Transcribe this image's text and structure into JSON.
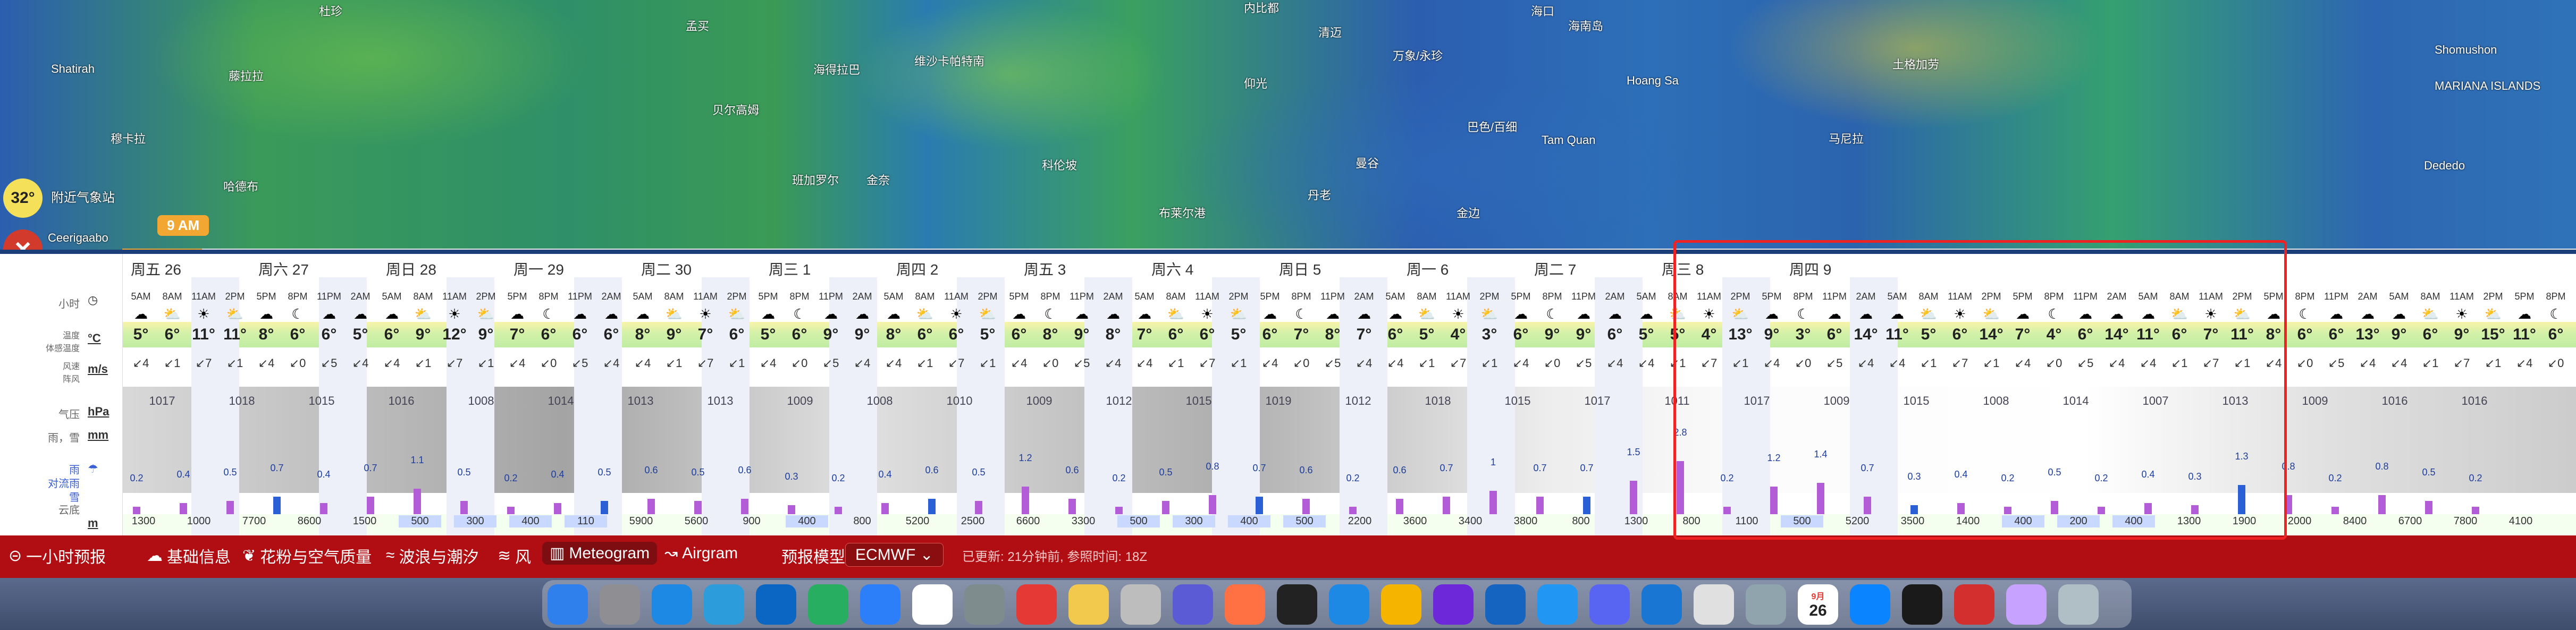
{
  "map": {
    "temp_badge": "32°",
    "nearby_station": "附近气象站",
    "time_tag": "9 AM",
    "cities": [
      {
        "name": "Shatirah"
      },
      {
        "name": "杜珍"
      },
      {
        "name": "藤拉拉"
      },
      {
        "name": "穆卡拉"
      },
      {
        "name": "哈德布"
      },
      {
        "name": "Ceerigaabo"
      },
      {
        "name": "孟买"
      },
      {
        "name": "海得拉巴"
      },
      {
        "name": "维沙卡帕特南"
      },
      {
        "name": "贝尔高姆"
      },
      {
        "name": "班加罗尔"
      },
      {
        "name": "金奈"
      },
      {
        "name": "科伦坡"
      },
      {
        "name": "内比都"
      },
      {
        "name": "清迈"
      },
      {
        "name": "曼谷"
      },
      {
        "name": "万象/永珍"
      },
      {
        "name": "仰光"
      },
      {
        "name": "巴色/百细"
      },
      {
        "name": "丹老"
      },
      {
        "name": "布莱尔港"
      },
      {
        "name": "海口"
      },
      {
        "name": "海南岛"
      },
      {
        "name": "Hoang Sa"
      },
      {
        "name": "Tam Quan"
      },
      {
        "name": "金边"
      },
      {
        "name": "马尼拉"
      },
      {
        "name": "土格加劳"
      },
      {
        "name": "Shomushon"
      },
      {
        "name": "MARIANA ISLANDS"
      },
      {
        "name": "Dededo"
      },
      {
        "name": "马尼拉"
      }
    ]
  },
  "meteogram": {
    "labels": {
      "hour": "小时",
      "temp": "温度\n体感温度",
      "temp_unit": "°C",
      "wind": "风速\n阵风",
      "wind_unit": "m/s",
      "pressure": "气压",
      "pressure_unit": "hPa",
      "rain_snow": "雨，雪",
      "rain_unit": "mm",
      "rain": "雨",
      "rain_hourly": "对流雨",
      "snow": "雪",
      "cloud_base": "云底",
      "cloud_unit": "m"
    },
    "days": [
      "周五 26",
      "周六 27",
      "周日 28",
      "周一 29",
      "周二 30",
      "周三 1",
      "周四 2",
      "周五 3",
      "周六 4",
      "周日 5",
      "周一 6",
      "周二 7",
      "周三 8",
      "周四 9"
    ],
    "hours": [
      "5AM",
      "8AM",
      "11AM",
      "2PM",
      "5PM",
      "8PM",
      "11PM",
      "2AM"
    ],
    "temps": [
      "5°",
      "6°",
      "11°",
      "11°",
      "8°",
      "6°",
      "6°",
      "5°",
      "6°",
      "9°",
      "12°",
      "9°",
      "7°",
      "6°",
      "6°",
      "6°",
      "8°",
      "9°",
      "7°",
      "6°",
      "5°",
      "6°",
      "9°",
      "9°",
      "8°",
      "6°",
      "6°",
      "5°",
      "6°",
      "8°",
      "9°",
      "8°",
      "7°",
      "6°",
      "6°",
      "5°",
      "6°",
      "7°",
      "8°",
      "7°",
      "6°",
      "5°",
      "4°",
      "3°",
      "6°",
      "9°",
      "9°",
      "6°",
      "5°",
      "5°",
      "4°",
      "13°",
      "9°",
      "3°",
      "6°",
      "14°",
      "11°",
      "5°",
      "6°",
      "14°",
      "7°",
      "4°",
      "6°",
      "14°",
      "11°",
      "6°",
      "7°",
      "11°",
      "8°",
      "6°",
      "6°",
      "13°",
      "9°",
      "6°",
      "9°",
      "15°",
      "11°",
      "6°"
    ],
    "pressures": [
      "1017",
      "1018",
      "1015",
      "1016",
      "1008",
      "1014",
      "1013",
      "1013",
      "1009",
      "1008",
      "1010",
      "1009",
      "1012",
      "1015",
      "1019",
      "1012",
      "1018",
      "1015",
      "1017",
      "1011",
      "1017",
      "1009",
      "1015",
      "1008",
      "1014",
      "1007",
      "1013",
      "1009",
      "1016",
      "1016"
    ],
    "precip_values": [
      "0.2",
      "0.4",
      "0.5",
      "0.7",
      "0.4",
      "0.7",
      "1.1",
      "0.5",
      "0.2",
      "0.4",
      "0.5",
      "0.6",
      "0.5",
      "0.6",
      "0.3",
      "0.2",
      "0.4",
      "0.6",
      "0.5",
      "1.2",
      "0.6",
      "0.2",
      "0.5",
      "0.8",
      "0.7",
      "0.6",
      "0.2",
      "0.6",
      "0.7",
      "1",
      "0.7",
      "0.7",
      "1.5",
      "2.8",
      "0.2",
      "1.2",
      "1.4",
      "0.7",
      "0.3",
      "0.4",
      "0.2",
      "0.5",
      "0.2",
      "0.4",
      "0.3",
      "1.3",
      "0.8",
      "0.2",
      "0.8",
      "0.5",
      "0.2"
    ],
    "cloud_base": [
      "1300",
      "1000",
      "7700",
      "8600",
      "1500",
      "500",
      "300",
      "400",
      "110",
      "5900",
      "5600",
      "900",
      "400",
      "800",
      "5200",
      "2500",
      "6600",
      "3300",
      "500",
      "300",
      "400",
      "500",
      "2200",
      "3600",
      "3400",
      "3800",
      "800",
      "1300",
      "800",
      "1100",
      "500",
      "5200",
      "3500",
      "1400",
      "400",
      "200",
      "400",
      "1300",
      "1900",
      "2000",
      "8400",
      "6700",
      "7800",
      "4100"
    ]
  },
  "toolbar": {
    "items": [
      "一小时预报",
      "基础信息",
      "花粉与空气质量",
      "波浪与潮汐",
      "风",
      "Meteogram",
      "Airgram"
    ],
    "model_label": "预报模型:",
    "model_value": "ECMWF",
    "updated": "已更新: 21分钟前, 参照时间: 18Z"
  },
  "dock": {
    "calendar_month": "9月",
    "calendar_day": "26",
    "apps": [
      "Finder",
      "Launchpad",
      "Safari",
      "Mail",
      "VS Code",
      "WeChat",
      "Lark",
      "Chrome",
      "System Settings",
      "NetEase Music",
      "Notes",
      "Preview",
      "Arc",
      "Firefox",
      "Terminal",
      "Feishu",
      "Notebook",
      "Feedback",
      "Xcode Tools",
      "Mail App",
      "Discord",
      "VPN",
      "Notes2",
      "Disk",
      "Calendar",
      "Edge",
      "Activity",
      "WPS",
      "Photos",
      "Trash"
    ]
  },
  "colors": {
    "toolbar_bg": "#b00e12",
    "highlight": "#e22222",
    "precip_rain": "#b35cd8",
    "precip_convective": "#2a5fd6"
  }
}
